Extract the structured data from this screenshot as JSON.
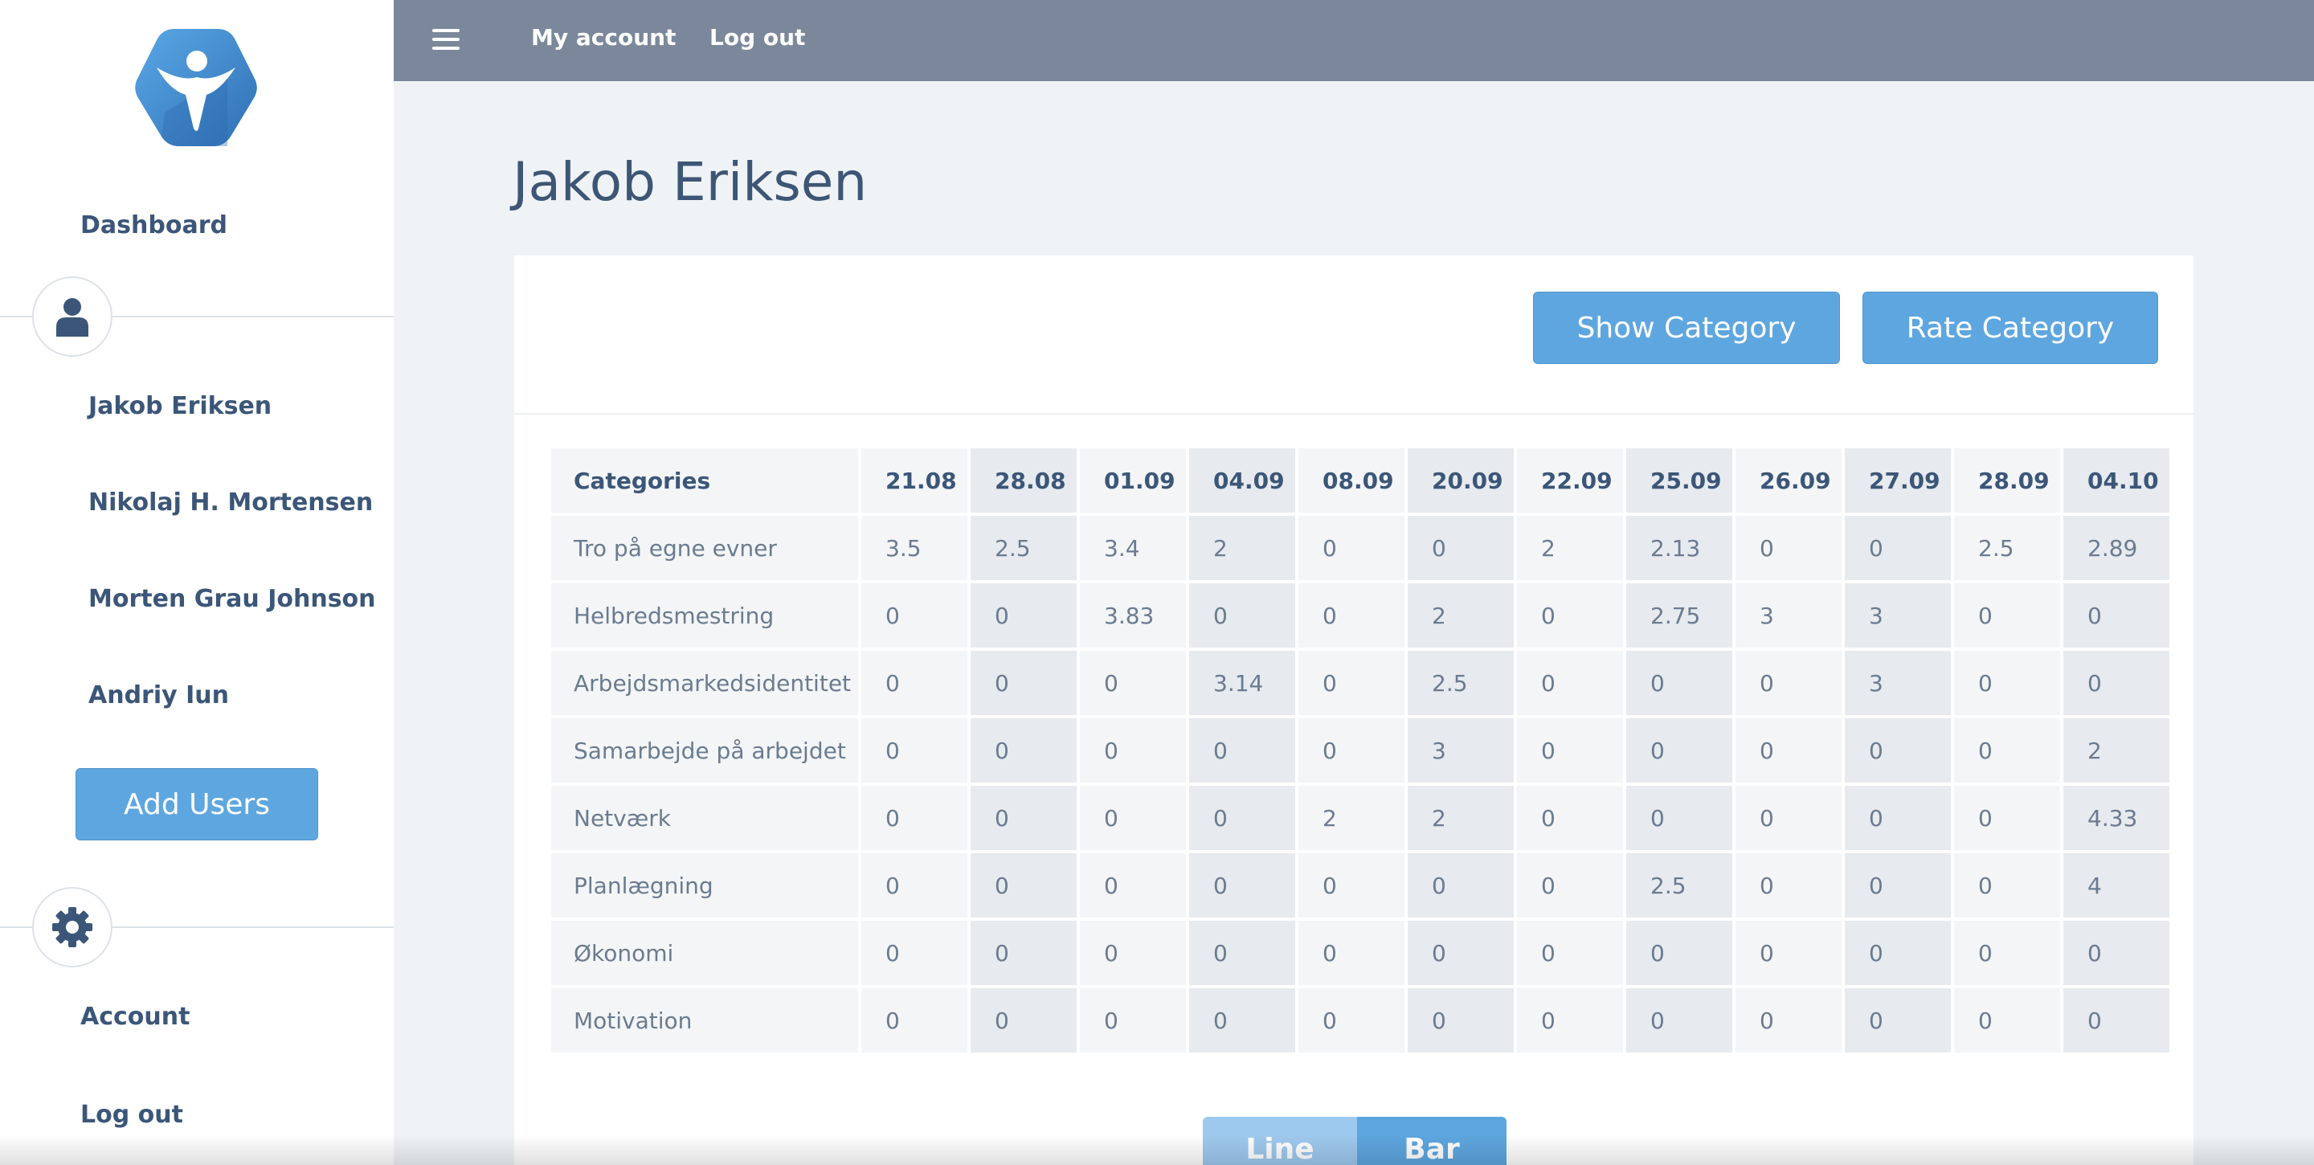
{
  "sidebar": {
    "dashboard": "Dashboard",
    "users": [
      "Jakob Eriksen",
      "Nikolaj H. Mortensen",
      "Morten Grau Johnson",
      "Andriy Iun"
    ],
    "add_users": "Add Users",
    "account": "Account",
    "logout": "Log out",
    "icons": [
      "logo-icon",
      "user-icon",
      "gear-icon"
    ]
  },
  "topbar": {
    "my_account": "My account",
    "logout": "Log out",
    "menu_icon": "hamburger-icon"
  },
  "page": {
    "title": "Jakob Eriksen"
  },
  "actions": {
    "show_category": "Show Category",
    "rate_category": "Rate Category"
  },
  "table": {
    "header_label": "Categories",
    "columns": [
      "21.08",
      "28.08",
      "01.09",
      "04.09",
      "08.09",
      "20.09",
      "22.09",
      "25.09",
      "26.09",
      "27.09",
      "28.09",
      "04.10"
    ],
    "rows": [
      {
        "label": "Tro på egne evner",
        "values": [
          "3.5",
          "2.5",
          "3.4",
          "2",
          "0",
          "0",
          "2",
          "2.13",
          "0",
          "0",
          "2.5",
          "2.89"
        ]
      },
      {
        "label": "Helbredsmestring",
        "values": [
          "0",
          "0",
          "3.83",
          "0",
          "0",
          "2",
          "0",
          "2.75",
          "3",
          "3",
          "0",
          "0"
        ]
      },
      {
        "label": "Arbejdsmarkedsidentitet",
        "values": [
          "0",
          "0",
          "0",
          "3.14",
          "0",
          "2.5",
          "0",
          "0",
          "0",
          "3",
          "0",
          "0"
        ]
      },
      {
        "label": "Samarbejde på arbejdet",
        "values": [
          "0",
          "0",
          "0",
          "0",
          "0",
          "3",
          "0",
          "0",
          "0",
          "0",
          "0",
          "2"
        ]
      },
      {
        "label": "Netværk",
        "values": [
          "0",
          "0",
          "0",
          "0",
          "2",
          "2",
          "0",
          "0",
          "0",
          "0",
          "0",
          "4.33"
        ]
      },
      {
        "label": "Planlægning",
        "values": [
          "0",
          "0",
          "0",
          "0",
          "0",
          "0",
          "0",
          "2.5",
          "0",
          "0",
          "0",
          "4"
        ]
      },
      {
        "label": "Økonomi",
        "values": [
          "0",
          "0",
          "0",
          "0",
          "0",
          "0",
          "0",
          "0",
          "0",
          "0",
          "0",
          "0"
        ]
      },
      {
        "label": "Motivation",
        "values": [
          "0",
          "0",
          "0",
          "0",
          "0",
          "0",
          "0",
          "0",
          "0",
          "0",
          "0",
          "0"
        ]
      }
    ]
  },
  "chart_toggle": {
    "line": "Line",
    "bar": "Bar",
    "selected": "Bar"
  },
  "colors": {
    "accent": "#5ea6df",
    "topbar": "#7b889b",
    "text": "#3e5675",
    "background": "#eff3f6"
  }
}
